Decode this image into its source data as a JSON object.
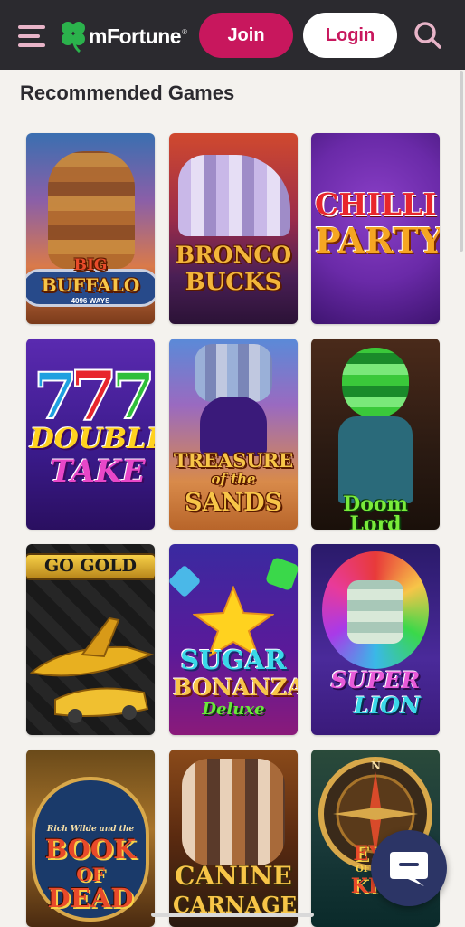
{
  "header": {
    "brand": "mFortune",
    "join_label": "Join",
    "login_label": "Login",
    "icons": [
      "menu-icon",
      "clover-logo-icon",
      "search-icon"
    ],
    "colors": {
      "bar": "#2b2a2f",
      "accent": "#c8175d",
      "menu": "#e8b4c8"
    }
  },
  "main": {
    "title": "Recommended Games",
    "games": [
      {
        "name": "Big Buffalo",
        "label_line1": "BIG",
        "label_line2": "BUFFALO",
        "sub": "4096 WAYS"
      },
      {
        "name": "Bronco Bucks",
        "label_line1": "BRONCO",
        "label_line2": "BUCKS"
      },
      {
        "name": "Chilli Party",
        "label_line1": "CHILLI",
        "label_line2": "PARTY"
      },
      {
        "name": "Double Take",
        "label_line1": "DOUBLE",
        "label_line2": "TAKE"
      },
      {
        "name": "Treasure of the Sands",
        "label_line1": "TREASURE",
        "label_line2": "of the",
        "label_line3": "SANDS"
      },
      {
        "name": "Doom Lord",
        "label_line1": "Doom Lord"
      },
      {
        "name": "Go for Gold",
        "label_line1": "GO GOLD"
      },
      {
        "name": "Sugar Bonanza Deluxe",
        "label_line1": "SUGAR",
        "label_line2": "BONANZA",
        "label_line3": "Deluxe"
      },
      {
        "name": "Super Lion",
        "label_line1": "SUPER",
        "label_line2": "LION"
      },
      {
        "name": "Book of Dead",
        "label_line1": "Rich Wilde and the",
        "label_line2": "BOOK",
        "label_line3": "OF",
        "label_line4": "DEAD"
      },
      {
        "name": "Canine Carnage",
        "label_line1": "CANINE",
        "label_line2": "CARNAGE"
      },
      {
        "name": "Eye of the Kraken",
        "label_line1": "EYE",
        "label_line2": "OF THE",
        "label_line3": "KRA"
      }
    ]
  },
  "chat": {
    "icon": "chat-bubble-icon"
  }
}
